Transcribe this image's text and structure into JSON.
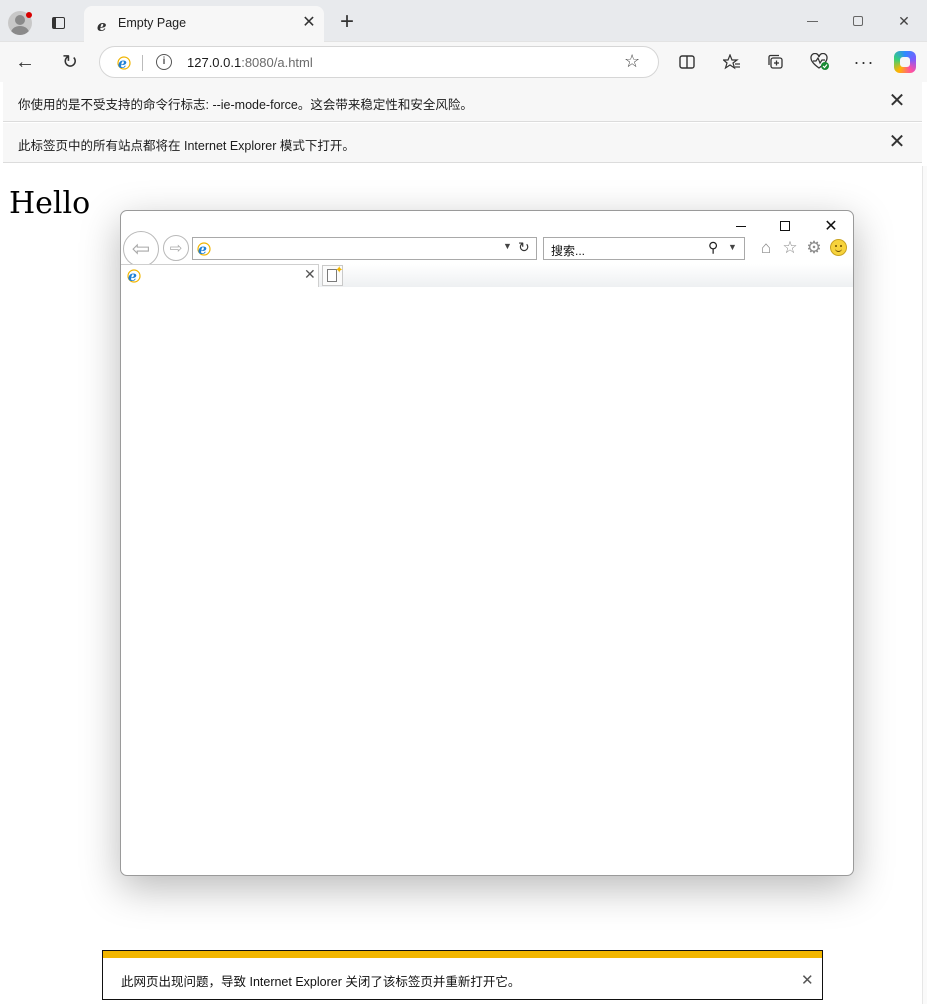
{
  "browser": {
    "tab_title": "Empty Page",
    "address": {
      "host": "127.0.0.1",
      "path": ":8080/a.html"
    }
  },
  "infobars": [
    {
      "message": "你使用的是不受支持的命令行标志: --ie-mode-force。这会带来稳定性和安全风险。"
    },
    {
      "message": "此标签页中的所有站点都将在 Internet Explorer 模式下打开。"
    }
  ],
  "page": {
    "heading": "Hello"
  },
  "ie_window": {
    "search_placeholder": "搜索..."
  },
  "notification": {
    "message": "此网页出现问题，导致 Internet Explorer 关闭了该标签页并重新打开它。",
    "accent_color": "#f2b600"
  },
  "icons": [
    "profile-icon",
    "tab-actions-icon",
    "ie-logo-icon",
    "close-icon",
    "new-tab-icon",
    "minimize-icon",
    "maximize-icon",
    "back-icon",
    "refresh-icon",
    "info-icon",
    "star-icon",
    "split-screen-icon",
    "favorites-icon",
    "collections-icon",
    "health-icon",
    "more-icon",
    "copilot-icon",
    "home-icon",
    "gear-icon",
    "smiley-icon",
    "search-icon"
  ]
}
